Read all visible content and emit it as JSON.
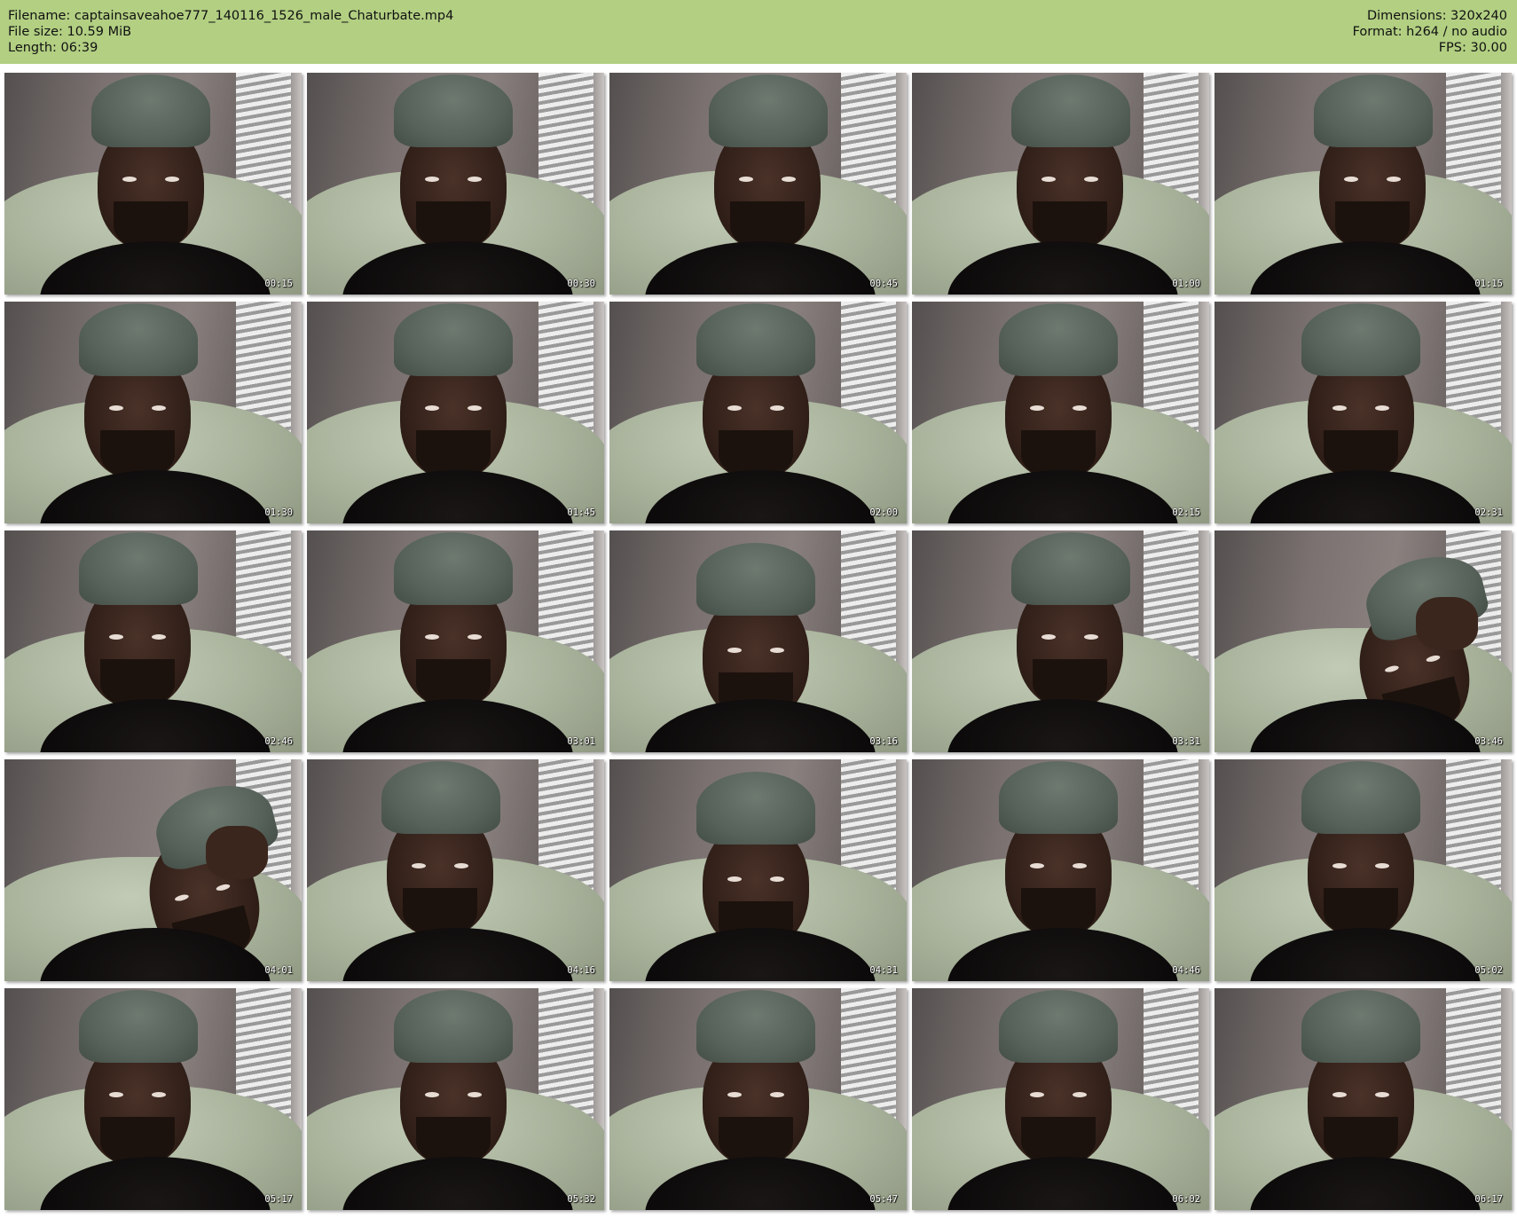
{
  "header": {
    "filename_label": "Filename: captainsaveahoe777_140116_1526_male_Chaturbate.mp4",
    "filesize_label": "File size: 10.59 MiB",
    "length_label": "Length: 06:39",
    "dimensions_label": "Dimensions: 320x240",
    "format_label": "Format: h264 / no audio",
    "fps_label": "FPS: 30.00"
  },
  "colors": {
    "header_background": "#b2cf82",
    "page_background": "#ffffff"
  },
  "thumbnails": [
    {
      "timestamp": "00:15",
      "pose": "center"
    },
    {
      "timestamp": "00:30",
      "pose": "center"
    },
    {
      "timestamp": "00:45",
      "pose": "right"
    },
    {
      "timestamp": "01:00",
      "pose": "right"
    },
    {
      "timestamp": "01:15",
      "pose": "right"
    },
    {
      "timestamp": "01:30",
      "pose": "left"
    },
    {
      "timestamp": "01:45",
      "pose": "center"
    },
    {
      "timestamp": "02:00",
      "pose": "center"
    },
    {
      "timestamp": "02:15",
      "pose": "center"
    },
    {
      "timestamp": "02:31",
      "pose": "center"
    },
    {
      "timestamp": "02:46",
      "pose": "left"
    },
    {
      "timestamp": "03:01",
      "pose": "center"
    },
    {
      "timestamp": "03:16",
      "pose": "low"
    },
    {
      "timestamp": "03:31",
      "pose": "right"
    },
    {
      "timestamp": "03:46",
      "pose": "tilt"
    },
    {
      "timestamp": "04:01",
      "pose": "tilt"
    },
    {
      "timestamp": "04:16",
      "pose": "left"
    },
    {
      "timestamp": "04:31",
      "pose": "low"
    },
    {
      "timestamp": "04:46",
      "pose": "center"
    },
    {
      "timestamp": "05:02",
      "pose": "center"
    },
    {
      "timestamp": "05:17",
      "pose": "left"
    },
    {
      "timestamp": "05:32",
      "pose": "center"
    },
    {
      "timestamp": "05:47",
      "pose": "center"
    },
    {
      "timestamp": "06:02",
      "pose": "center"
    },
    {
      "timestamp": "06:17",
      "pose": "center"
    }
  ]
}
